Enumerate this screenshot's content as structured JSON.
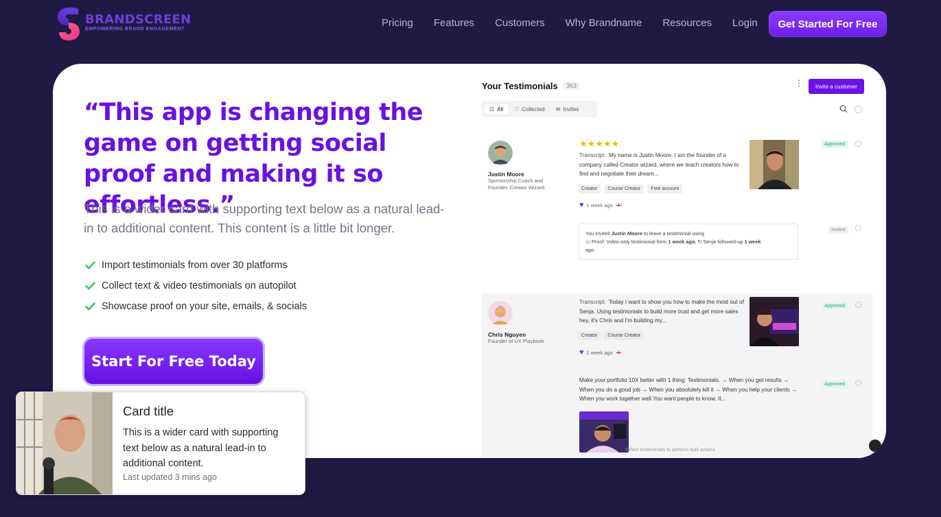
{
  "brand": {
    "name": "BRANDSCREEN",
    "tagline": "EMPOWERING BRAND ENGAGEMENT"
  },
  "nav": {
    "items": [
      "Pricing",
      "Features",
      "Customers",
      "Why Brandname",
      "Resources",
      "Login"
    ],
    "cta": "Get Started For Free"
  },
  "hero": {
    "quote": "“This app is changing the game on getting social proof and making it so effortless.”",
    "support": "This is a wider card with supporting text below as a natural lead-in to additional content. This content is a little bit longer.",
    "checks": [
      "Import testimonials from over 30 platforms",
      "Collect text & video testimonials on autopilot",
      "Showcase proof on your site, emails, & socials"
    ],
    "button": "Start For Free Today"
  },
  "dashboard": {
    "title": "Your Testimonials",
    "count": "363",
    "invite_button": "Invite a customer",
    "tabs": [
      "All",
      "Collected",
      "Invites"
    ],
    "testimonial1": {
      "name": "Justin Moore",
      "role": "Sponsorship Coach and Founder, Creator Wizard",
      "stars": "★★★★★",
      "transcript_label": "Transcript:",
      "transcript": "My name is Justin Moore. I am the founder of a company called Creator wizard, where we teach creators how to find and negotiate their dream...",
      "tags": [
        "Creator",
        "Course Creator",
        "Free account"
      ],
      "time": "1 week ago",
      "status": "Approved"
    },
    "invite": {
      "line1_a": "You invited",
      "line1_name": "Justin Moore",
      "line1_b": "to leave a testimonial using",
      "line2_a": "Proof: Video-only testimonial form",
      "line2_time": "1 week ago.",
      "line2_b": "Senja followed-up",
      "line2_time2": "1 week",
      "line3": "ago.",
      "status": "Invited"
    },
    "testimonial2": {
      "name": "Chris Nguyen",
      "role": "Founder of UX Playbook",
      "transcript_label": "Transcript:",
      "transcript": "Today I want to show you how to make the most out of Senja. Using testimonials to build more trust and get more sales hey, it's Chris and I'm building my...",
      "tags": [
        "Creator",
        "Course Creator"
      ],
      "time": "1 week ago",
      "status": "Approved"
    },
    "testimonial3": {
      "text": "Make your portfolio 10X better with 1 thing: Testimonials. → When you get results → When you do a good job → When you absolutely kill it → When you help your clients → When you work together well You want people to know. It...",
      "status": "Approved"
    },
    "bulk_hint": "Select testimonials to perform bulk actions"
  },
  "float_card": {
    "title": "Card title",
    "text": "This is a wider card with supporting text below as a natural lead-in to additional content.",
    "updated": "Last updated 3 mins ago"
  },
  "colors": {
    "background": "#1f1a44",
    "accent": "#6a11e0",
    "check": "#34c759",
    "approved": "#1aa37a"
  }
}
